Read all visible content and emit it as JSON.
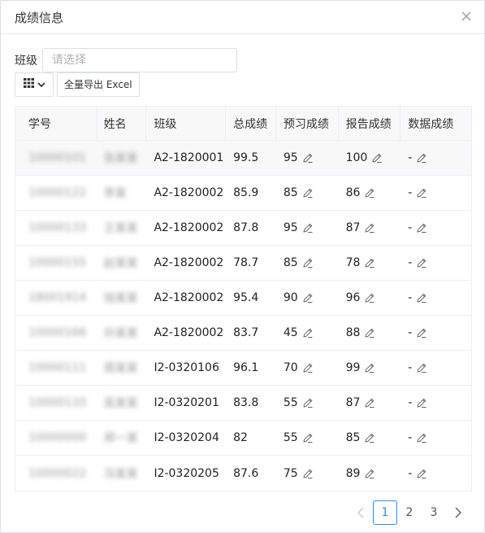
{
  "dialog": {
    "title": "成绩信息"
  },
  "filter": {
    "label": "班级",
    "placeholder": "请选择"
  },
  "toolbar": {
    "export_label": "全量导出 Excel"
  },
  "table": {
    "headers": [
      "学号",
      "姓名",
      "班级",
      "总成绩",
      "预习成绩",
      "报告成绩",
      "数据成绩"
    ],
    "rows": [
      {
        "id": "10000101",
        "name": "张某某",
        "class": "A2-1820001",
        "total": "99.5",
        "preview": "95",
        "report": "100",
        "data": "-"
      },
      {
        "id": "10000122",
        "name": "李某",
        "class": "A2-1820002",
        "total": "85.9",
        "preview": "85",
        "report": "86",
        "data": "-"
      },
      {
        "id": "10000133",
        "name": "王某某",
        "class": "A2-1820002",
        "total": "87.8",
        "preview": "95",
        "report": "87",
        "data": "-"
      },
      {
        "id": "10000155",
        "name": "赵某某",
        "class": "A2-1820002",
        "total": "78.7",
        "preview": "85",
        "report": "78",
        "data": "-"
      },
      {
        "id": "18001914",
        "name": "钱某某",
        "class": "A2-1820002",
        "total": "95.4",
        "preview": "90",
        "report": "96",
        "data": "-"
      },
      {
        "id": "10000166",
        "name": "孙某某",
        "class": "A2-1820002",
        "total": "83.7",
        "preview": "45",
        "report": "88",
        "data": "-"
      },
      {
        "id": "10000111",
        "name": "周某某",
        "class": "I2-0320106",
        "total": "96.1",
        "preview": "70",
        "report": "99",
        "data": "-"
      },
      {
        "id": "10000133",
        "name": "吴某某",
        "class": "I2-0320201",
        "total": "83.8",
        "preview": "55",
        "report": "87",
        "data": "-"
      },
      {
        "id": "10000000",
        "name": "郑一某",
        "class": "I2-0320204",
        "total": "82",
        "preview": "55",
        "report": "85",
        "data": "-"
      },
      {
        "id": "10000022",
        "name": "冯某某",
        "class": "I2-0320205",
        "total": "87.6",
        "preview": "75",
        "report": "89",
        "data": "-"
      }
    ]
  },
  "pagination": {
    "pages": [
      "1",
      "2",
      "3"
    ],
    "current": "1"
  },
  "colors": {
    "accent": "#2d8cf0",
    "header_bg": "#f8f8f9",
    "border": "#ebeef5"
  }
}
